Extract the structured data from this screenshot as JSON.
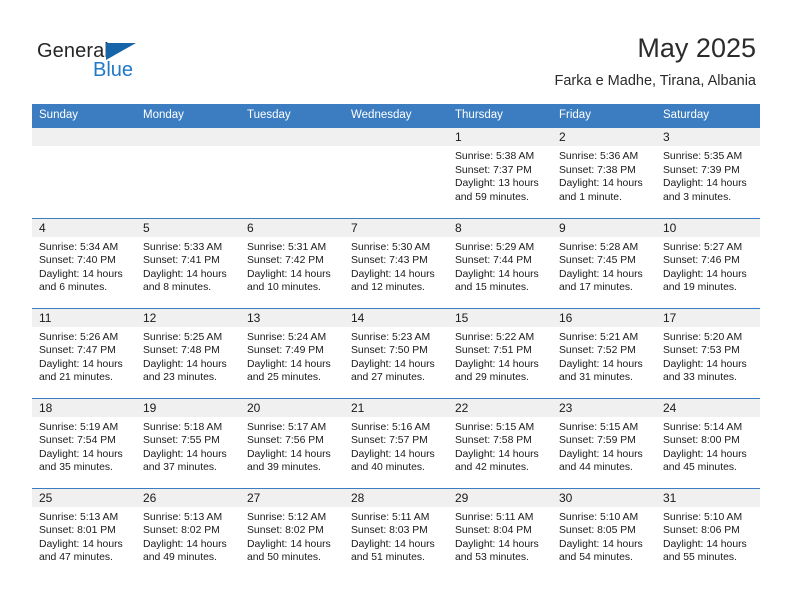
{
  "brand": {
    "name_top": "General",
    "name_bottom": "Blue",
    "colors": {
      "accent": "#3b7dc0",
      "logo_blue": "#2079c7",
      "triangle": "#1565a8"
    }
  },
  "header": {
    "title": "May 2025",
    "subtitle": "Farka e Madhe, Tirana, Albania"
  },
  "calendar": {
    "weekday_headers": [
      "Sunday",
      "Monday",
      "Tuesday",
      "Wednesday",
      "Thursday",
      "Friday",
      "Saturday"
    ],
    "weeks": [
      [
        {
          "day": "",
          "empty": true
        },
        {
          "day": "",
          "empty": true
        },
        {
          "day": "",
          "empty": true
        },
        {
          "day": "",
          "empty": true
        },
        {
          "day": "1",
          "sunrise": "Sunrise: 5:38 AM",
          "sunset": "Sunset: 7:37 PM",
          "daylight_line1": "Daylight: 13 hours",
          "daylight_line2": "and 59 minutes."
        },
        {
          "day": "2",
          "sunrise": "Sunrise: 5:36 AM",
          "sunset": "Sunset: 7:38 PM",
          "daylight_line1": "Daylight: 14 hours",
          "daylight_line2": "and 1 minute."
        },
        {
          "day": "3",
          "sunrise": "Sunrise: 5:35 AM",
          "sunset": "Sunset: 7:39 PM",
          "daylight_line1": "Daylight: 14 hours",
          "daylight_line2": "and 3 minutes."
        }
      ],
      [
        {
          "day": "4",
          "sunrise": "Sunrise: 5:34 AM",
          "sunset": "Sunset: 7:40 PM",
          "daylight_line1": "Daylight: 14 hours",
          "daylight_line2": "and 6 minutes."
        },
        {
          "day": "5",
          "sunrise": "Sunrise: 5:33 AM",
          "sunset": "Sunset: 7:41 PM",
          "daylight_line1": "Daylight: 14 hours",
          "daylight_line2": "and 8 minutes."
        },
        {
          "day": "6",
          "sunrise": "Sunrise: 5:31 AM",
          "sunset": "Sunset: 7:42 PM",
          "daylight_line1": "Daylight: 14 hours",
          "daylight_line2": "and 10 minutes."
        },
        {
          "day": "7",
          "sunrise": "Sunrise: 5:30 AM",
          "sunset": "Sunset: 7:43 PM",
          "daylight_line1": "Daylight: 14 hours",
          "daylight_line2": "and 12 minutes."
        },
        {
          "day": "8",
          "sunrise": "Sunrise: 5:29 AM",
          "sunset": "Sunset: 7:44 PM",
          "daylight_line1": "Daylight: 14 hours",
          "daylight_line2": "and 15 minutes."
        },
        {
          "day": "9",
          "sunrise": "Sunrise: 5:28 AM",
          "sunset": "Sunset: 7:45 PM",
          "daylight_line1": "Daylight: 14 hours",
          "daylight_line2": "and 17 minutes."
        },
        {
          "day": "10",
          "sunrise": "Sunrise: 5:27 AM",
          "sunset": "Sunset: 7:46 PM",
          "daylight_line1": "Daylight: 14 hours",
          "daylight_line2": "and 19 minutes."
        }
      ],
      [
        {
          "day": "11",
          "sunrise": "Sunrise: 5:26 AM",
          "sunset": "Sunset: 7:47 PM",
          "daylight_line1": "Daylight: 14 hours",
          "daylight_line2": "and 21 minutes."
        },
        {
          "day": "12",
          "sunrise": "Sunrise: 5:25 AM",
          "sunset": "Sunset: 7:48 PM",
          "daylight_line1": "Daylight: 14 hours",
          "daylight_line2": "and 23 minutes."
        },
        {
          "day": "13",
          "sunrise": "Sunrise: 5:24 AM",
          "sunset": "Sunset: 7:49 PM",
          "daylight_line1": "Daylight: 14 hours",
          "daylight_line2": "and 25 minutes."
        },
        {
          "day": "14",
          "sunrise": "Sunrise: 5:23 AM",
          "sunset": "Sunset: 7:50 PM",
          "daylight_line1": "Daylight: 14 hours",
          "daylight_line2": "and 27 minutes."
        },
        {
          "day": "15",
          "sunrise": "Sunrise: 5:22 AM",
          "sunset": "Sunset: 7:51 PM",
          "daylight_line1": "Daylight: 14 hours",
          "daylight_line2": "and 29 minutes."
        },
        {
          "day": "16",
          "sunrise": "Sunrise: 5:21 AM",
          "sunset": "Sunset: 7:52 PM",
          "daylight_line1": "Daylight: 14 hours",
          "daylight_line2": "and 31 minutes."
        },
        {
          "day": "17",
          "sunrise": "Sunrise: 5:20 AM",
          "sunset": "Sunset: 7:53 PM",
          "daylight_line1": "Daylight: 14 hours",
          "daylight_line2": "and 33 minutes."
        }
      ],
      [
        {
          "day": "18",
          "sunrise": "Sunrise: 5:19 AM",
          "sunset": "Sunset: 7:54 PM",
          "daylight_line1": "Daylight: 14 hours",
          "daylight_line2": "and 35 minutes."
        },
        {
          "day": "19",
          "sunrise": "Sunrise: 5:18 AM",
          "sunset": "Sunset: 7:55 PM",
          "daylight_line1": "Daylight: 14 hours",
          "daylight_line2": "and 37 minutes."
        },
        {
          "day": "20",
          "sunrise": "Sunrise: 5:17 AM",
          "sunset": "Sunset: 7:56 PM",
          "daylight_line1": "Daylight: 14 hours",
          "daylight_line2": "and 39 minutes."
        },
        {
          "day": "21",
          "sunrise": "Sunrise: 5:16 AM",
          "sunset": "Sunset: 7:57 PM",
          "daylight_line1": "Daylight: 14 hours",
          "daylight_line2": "and 40 minutes."
        },
        {
          "day": "22",
          "sunrise": "Sunrise: 5:15 AM",
          "sunset": "Sunset: 7:58 PM",
          "daylight_line1": "Daylight: 14 hours",
          "daylight_line2": "and 42 minutes."
        },
        {
          "day": "23",
          "sunrise": "Sunrise: 5:15 AM",
          "sunset": "Sunset: 7:59 PM",
          "daylight_line1": "Daylight: 14 hours",
          "daylight_line2": "and 44 minutes."
        },
        {
          "day": "24",
          "sunrise": "Sunrise: 5:14 AM",
          "sunset": "Sunset: 8:00 PM",
          "daylight_line1": "Daylight: 14 hours",
          "daylight_line2": "and 45 minutes."
        }
      ],
      [
        {
          "day": "25",
          "sunrise": "Sunrise: 5:13 AM",
          "sunset": "Sunset: 8:01 PM",
          "daylight_line1": "Daylight: 14 hours",
          "daylight_line2": "and 47 minutes."
        },
        {
          "day": "26",
          "sunrise": "Sunrise: 5:13 AM",
          "sunset": "Sunset: 8:02 PM",
          "daylight_line1": "Daylight: 14 hours",
          "daylight_line2": "and 49 minutes."
        },
        {
          "day": "27",
          "sunrise": "Sunrise: 5:12 AM",
          "sunset": "Sunset: 8:02 PM",
          "daylight_line1": "Daylight: 14 hours",
          "daylight_line2": "and 50 minutes."
        },
        {
          "day": "28",
          "sunrise": "Sunrise: 5:11 AM",
          "sunset": "Sunset: 8:03 PM",
          "daylight_line1": "Daylight: 14 hours",
          "daylight_line2": "and 51 minutes."
        },
        {
          "day": "29",
          "sunrise": "Sunrise: 5:11 AM",
          "sunset": "Sunset: 8:04 PM",
          "daylight_line1": "Daylight: 14 hours",
          "daylight_line2": "and 53 minutes."
        },
        {
          "day": "30",
          "sunrise": "Sunrise: 5:10 AM",
          "sunset": "Sunset: 8:05 PM",
          "daylight_line1": "Daylight: 14 hours",
          "daylight_line2": "and 54 minutes."
        },
        {
          "day": "31",
          "sunrise": "Sunrise: 5:10 AM",
          "sunset": "Sunset: 8:06 PM",
          "daylight_line1": "Daylight: 14 hours",
          "daylight_line2": "and 55 minutes."
        }
      ]
    ]
  }
}
